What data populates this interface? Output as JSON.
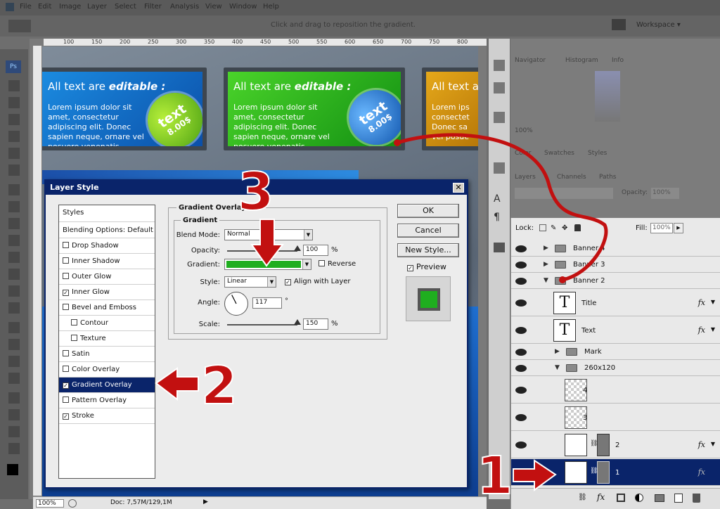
{
  "menu": [
    "File",
    "Edit",
    "Image",
    "Layer",
    "Select",
    "Filter",
    "Analysis",
    "View",
    "Window",
    "Help"
  ],
  "optbar": {
    "hint": "Click and drag to reposition the gradient.",
    "workspace": "Workspace ▾"
  },
  "ruler_ticks": [
    "100",
    "150",
    "200",
    "250",
    "300",
    "350",
    "400",
    "450",
    "500",
    "550",
    "600",
    "650",
    "700",
    "750",
    "800"
  ],
  "banners": [
    {
      "title": "All text are ",
      "title_em": "editable :",
      "body": "Lorem ipsum dolor sit amet, consectetur adipiscing elit. Donec sapien neque, ornare vel posuere venenatis",
      "badge_text": "text",
      "badge_price": "8.00$"
    },
    {
      "title": "All text are ",
      "title_em": "editable :",
      "body": "Lorem ipsum dolor sit amet, consectetur adipiscing elit. Donec sapien neque, ornare vel posuere venenatis",
      "badge_text": "text",
      "badge_price": "8.00$"
    },
    {
      "title": "All text a",
      "title_em": "",
      "body": "Lorem ips consectet Donec sa vel posue",
      "badge_text": "",
      "badge_price": ""
    }
  ],
  "status": {
    "zoom": "100%",
    "doc": "Doc: 7,57M/129,1M"
  },
  "panels": {
    "navigator": "Navigator",
    "histogram": "Histogram",
    "info": "Info",
    "color": "Color",
    "swatches": "Swatches",
    "styles": "Styles",
    "layers": "Layers",
    "channels": "Channels",
    "paths": "Paths",
    "opacity_label": "Opacity:",
    "opacity": "100%",
    "fill_label": "Fill:",
    "fill": "100%",
    "lock_label": "Lock:",
    "nav_zoom": "100%"
  },
  "layers": [
    {
      "name": "Banner 4",
      "kind": "group"
    },
    {
      "name": "Banner 3",
      "kind": "group"
    },
    {
      "name": "Banner 2",
      "kind": "group-open"
    },
    {
      "name": "Title",
      "kind": "text"
    },
    {
      "name": "Text",
      "kind": "text"
    },
    {
      "name": "Mark",
      "kind": "group"
    },
    {
      "name": "260x120",
      "kind": "group-open"
    },
    {
      "name": "4",
      "kind": "pixel"
    },
    {
      "name": "3",
      "kind": "pixel"
    },
    {
      "name": "2",
      "kind": "masked"
    },
    {
      "name": "1",
      "kind": "masked-selected"
    }
  ],
  "dialog": {
    "title": "Layer Style",
    "close": "✕",
    "styles_header": "Styles",
    "styles": [
      {
        "label": "Blending Options: Default",
        "check": null
      },
      {
        "label": "Drop Shadow",
        "check": false
      },
      {
        "label": "Inner Shadow",
        "check": false
      },
      {
        "label": "Outer Glow",
        "check": false
      },
      {
        "label": "Inner Glow",
        "check": true
      },
      {
        "label": "Bevel and Emboss",
        "check": false
      },
      {
        "label": "Contour",
        "check": false
      },
      {
        "label": "Texture",
        "check": false
      },
      {
        "label": "Satin",
        "check": false
      },
      {
        "label": "Color Overlay",
        "check": false
      },
      {
        "label": "Gradient Overlay",
        "check": true
      },
      {
        "label": "Pattern Overlay",
        "check": false
      },
      {
        "label": "Stroke",
        "check": true
      }
    ],
    "section": "Gradient Overlay",
    "subsection": "Gradient",
    "blend_label": "Blend Mode:",
    "blend_value": "Normal",
    "opacity_label": "Opacity:",
    "opacity_value": "100",
    "opacity_fraction": 1.0,
    "gradient_label": "Gradient:",
    "gradient_color": "#1fae1f",
    "reverse_label": "Reverse",
    "style_label": "Style:",
    "style_value": "Linear",
    "align_label": "Align with Layer",
    "angle_label": "Angle:",
    "angle_value": "117",
    "scale_label": "Scale:",
    "scale_value": "150",
    "scale_fraction": 1.0,
    "percent": "%",
    "degree": "°",
    "ok": "OK",
    "cancel": "Cancel",
    "new_style": "New Style...",
    "preview_label": "Preview"
  },
  "annotations": {
    "n1": "1",
    "n2": "2",
    "n3": "3"
  },
  "colors": {
    "annotation_red": "#c21010",
    "selection_blue": "#0a246a",
    "preview_green": "#1fae1f"
  }
}
